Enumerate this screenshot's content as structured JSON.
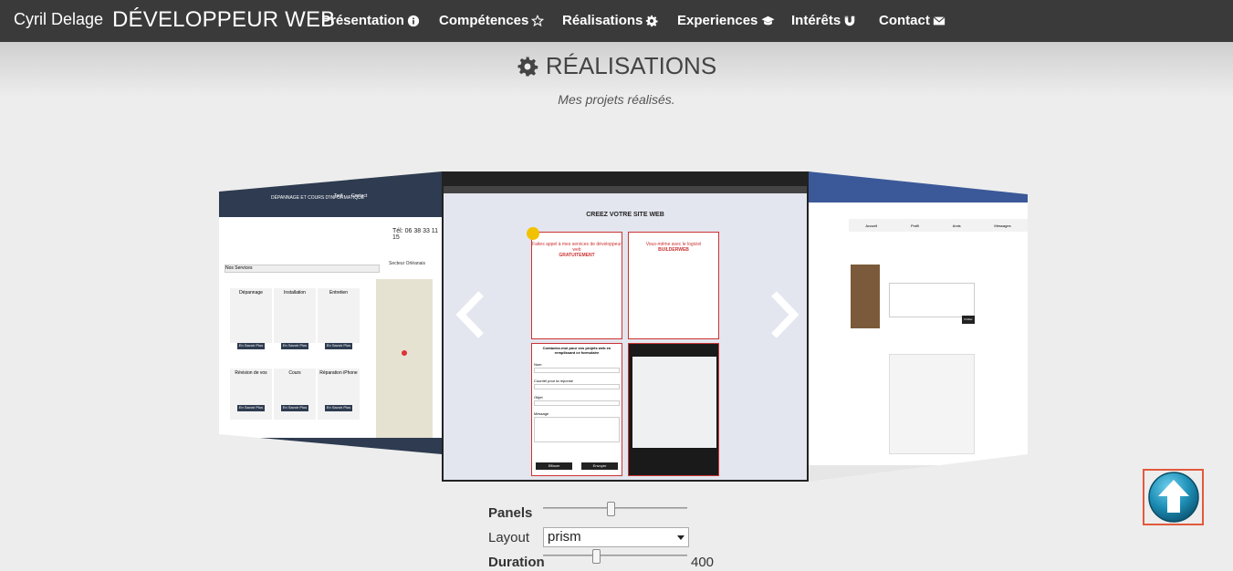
{
  "navbar": {
    "brand_name": "Cyril Delage",
    "brand_title": "DÉVELOPPEUR WEB",
    "items": [
      {
        "label": "Présentation",
        "icon": "info-icon"
      },
      {
        "label": "Compétences",
        "icon": "star-icon"
      },
      {
        "label": "Réalisations",
        "icon": "gear-icon"
      },
      {
        "label": "Experiences",
        "icon": "graduation-cap-icon"
      },
      {
        "label": "Intérêts",
        "icon": "magnet-icon"
      },
      {
        "label": "Contact",
        "icon": "envelope-icon"
      }
    ]
  },
  "section": {
    "title": "RÉALISATIONS",
    "subtitle": "Mes projets réalisés."
  },
  "carousel": {
    "left_panel": {
      "phone": "Tél: 06 38 33 11 15",
      "nav_title": "DÉPANNAGE ET COURS D'INFORMATIQUE",
      "nav_links": [
        "Tarif",
        "Contact"
      ],
      "services_label": "Nos Services",
      "sector_label": "Secteur Orléanais",
      "services": [
        {
          "title": "Dépannage",
          "button": "En Savoir Plus"
        },
        {
          "title": "Installation",
          "button": "En Savoir Plus"
        },
        {
          "title": "Entretien",
          "button": "En Savoir Plus"
        },
        {
          "title": "Révision de vos",
          "button": "En Savoir Plus"
        },
        {
          "title": "Cours",
          "button": "En Savoir Plus"
        },
        {
          "title": "Réparation iPhone",
          "button": "En Savoir Plus"
        }
      ]
    },
    "center_panel": {
      "heading": "CREEZ VOTRE SITE WEB",
      "card1_title": "Faites appel à mes services de développeur web",
      "card1_highlight": "GRATUITEMENT",
      "card2_title": "Vous-même avec le logiciel",
      "card2_highlight": "BUILDERWEB",
      "form_title": "Contactez-moi pour vos projets web en remplissant ce formulaire",
      "form_labels": [
        "Nom",
        "Courriel pour la réponse",
        "Objet",
        "Message"
      ],
      "form_buttons": [
        "Effacer",
        "Envoyer"
      ]
    },
    "right_panel": {
      "tabs": [
        "Accueil",
        "Profil",
        "Amis",
        "Messages"
      ],
      "button": "Publier"
    },
    "prev_icon": "chevron-left-icon",
    "next_icon": "chevron-right-icon"
  },
  "controls": {
    "panels_label": "Panels",
    "layout_label": "Layout",
    "layout_value": "prism",
    "duration_label": "Duration",
    "duration_value": "400",
    "panels_level": 0.47,
    "duration_level": 0.36
  },
  "scroll_top": {
    "icon": "arrow-up-circle-icon"
  },
  "colors": {
    "navbar": "#3a3a3a",
    "accent": "#e25a3c",
    "scroll_button": "#1e8fb6"
  }
}
